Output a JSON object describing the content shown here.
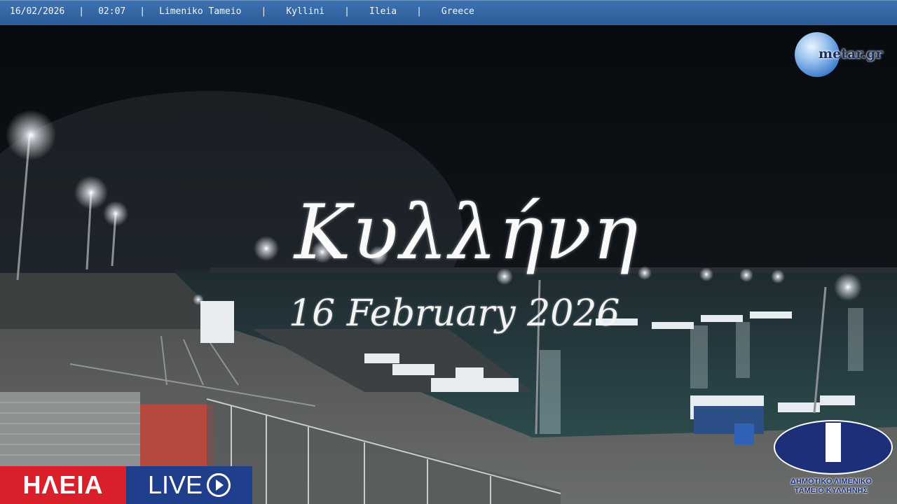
{
  "overlay": {
    "date": "16/02/2026",
    "time": "02:07",
    "location": "Limeniko Tameio",
    "town": "Kyllini",
    "region": "Ileia",
    "country": "Greece",
    "separator": "|"
  },
  "watermark": {
    "brand": "metar.gr"
  },
  "caption": {
    "title": "Κυλλήνη",
    "date": "16 February 2026"
  },
  "live_logo": {
    "left": "ΗΛΕΙΑ",
    "right": "LIVE"
  },
  "port_logo": {
    "line1": "ΔΗΜΟΤΙΚΟ ΛΙΜΕΝΙΚΟ",
    "line2": "ΤΑΜΕΙΟ ΚΥΛΛΗΝΗΣ"
  },
  "colors": {
    "bar": "#3569a8",
    "live_red": "#d81f2a",
    "live_blue": "#1f3e8c",
    "port_blue": "#1d2f78"
  }
}
